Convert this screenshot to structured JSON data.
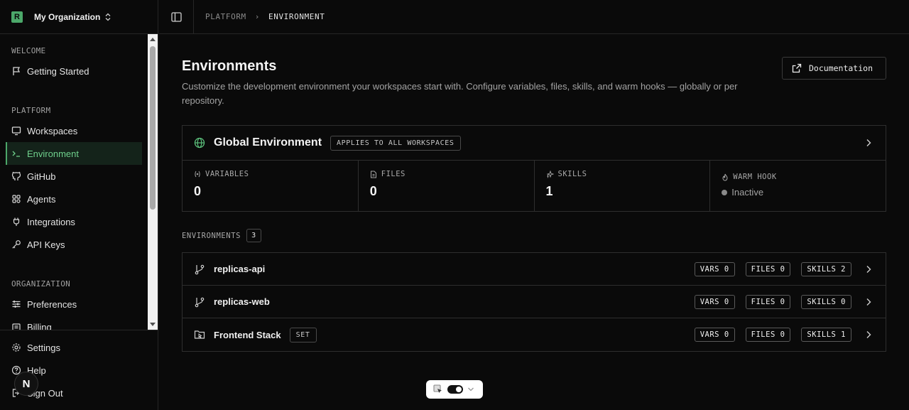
{
  "org": {
    "logo": "R",
    "name": "My Organization"
  },
  "sidebar": {
    "sections": [
      {
        "label": "WELCOME"
      },
      {
        "label": "PLATFORM"
      },
      {
        "label": "ORGANIZATION"
      }
    ],
    "items": [
      {
        "label": "Getting Started",
        "icon": "flag-icon"
      },
      {
        "label": "Workspaces",
        "icon": "monitor-icon"
      },
      {
        "label": "Environment",
        "icon": "terminal-icon",
        "active": true
      },
      {
        "label": "GitHub",
        "icon": "github-icon"
      },
      {
        "label": "Agents",
        "icon": "agents-icon"
      },
      {
        "label": "Integrations",
        "icon": "plug-icon"
      },
      {
        "label": "API Keys",
        "icon": "key-icon"
      },
      {
        "label": "Preferences",
        "icon": "sliders-icon"
      },
      {
        "label": "Billing",
        "icon": "billing-icon"
      }
    ],
    "footer": [
      {
        "label": "Settings",
        "icon": "gear-icon"
      },
      {
        "label": "Help",
        "icon": "help-icon"
      },
      {
        "label": "Sign Out",
        "icon": "signout-icon"
      }
    ]
  },
  "breadcrumb": {
    "parent": "PLATFORM",
    "current": "ENVIRONMENT"
  },
  "page": {
    "title": "Environments",
    "description": "Customize the development environment your workspaces start with. Configure variables, files, skills, and warm hooks — globally or per repository.",
    "doc_button": "Documentation"
  },
  "global_env": {
    "title": "Global Environment",
    "badge": "APPLIES TO ALL WORKSPACES",
    "stats": [
      {
        "label": "VARIABLES",
        "value": "0"
      },
      {
        "label": "FILES",
        "value": "0"
      },
      {
        "label": "SKILLS",
        "value": "1"
      }
    ],
    "warm_hook": {
      "label": "WARM HOOK",
      "status": "Inactive"
    }
  },
  "environments": {
    "label": "ENVIRONMENTS",
    "count": "3",
    "rows": [
      {
        "name": "replicas-api",
        "icon": "branch-icon",
        "vars": "VARS 0",
        "files": "FILES 0",
        "skills": "SKILLS 2"
      },
      {
        "name": "replicas-web",
        "icon": "branch-icon",
        "vars": "VARS 0",
        "files": "FILES 0",
        "skills": "SKILLS 0"
      },
      {
        "name": "Frontend Stack",
        "icon": "folder-set-icon",
        "badge": "SET",
        "vars": "VARS 0",
        "files": "FILES 0",
        "skills": "SKILLS 1"
      }
    ]
  },
  "floating": {
    "avatar_letter": "N"
  }
}
